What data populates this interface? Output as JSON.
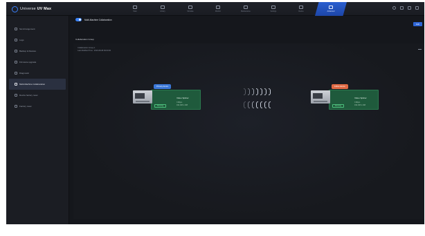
{
  "app": {
    "title_light": "Universe ",
    "title_bold": "UV Max"
  },
  "nav": [
    {
      "label": "Scan",
      "icon": "scan-icon",
      "active": false
    },
    {
      "label": "Library",
      "icon": "library-icon",
      "active": false
    },
    {
      "label": "Simulate",
      "icon": "simulate-icon",
      "active": false
    },
    {
      "label": "Monitor",
      "icon": "monitor-icon",
      "active": false
    },
    {
      "label": "Maintenance",
      "icon": "maintenance-icon",
      "active": false
    },
    {
      "label": "Settings",
      "icon": "settings-icon",
      "active": false
    },
    {
      "label": "Device",
      "icon": "device-icon",
      "active": false
    },
    {
      "label": "Advanced",
      "icon": "advanced-icon",
      "active": true
    }
  ],
  "window_controls": [
    "user-icon",
    "minimize-icon",
    "restore-icon",
    "close-icon"
  ],
  "sidebar": {
    "items": [
      {
        "label": "Set Arrangement",
        "icon": "arrangement-icon"
      },
      {
        "label": "Logs",
        "icon": "logs-icon"
      },
      {
        "label": "Backup & Restore",
        "icon": "backup-icon"
      },
      {
        "label": "Firmware upgrade",
        "icon": "upgrade-icon"
      },
      {
        "label": "Diagnostic",
        "icon": "diagnostic-icon"
      },
      {
        "label": "Multi-Machine Collaboration",
        "icon": "collaboration-icon",
        "active": true
      },
      {
        "label": "Device factory reset",
        "icon": "reset-icon"
      },
      {
        "label": "Factory reset",
        "icon": "factory-icon"
      }
    ]
  },
  "main": {
    "toggle_on": true,
    "title": "Multi-Machine Collaboration",
    "edit_label": "Edit",
    "section_title": "Collaboration Group",
    "group": {
      "name": "Collaboration Group 1",
      "last_modified": "Last Modified Time : 2023-08-08 09:00:00"
    },
    "devices": [
      {
        "role": "Primary device",
        "name": "Video Splicer",
        "sub1": "3 Mbps",
        "sub2": "192.168.1.168",
        "status": "Running"
      },
      {
        "role": "Follow device",
        "name": "Video Splicer",
        "sub1": "3 Mbps",
        "sub2": "192.168.1.168",
        "status": "Running"
      }
    ]
  },
  "colors": {
    "accent": "#2f66d6",
    "card_green": "#1f5a3c",
    "primary_tag": "#3b78d8",
    "follow_tag": "#e06a44"
  }
}
